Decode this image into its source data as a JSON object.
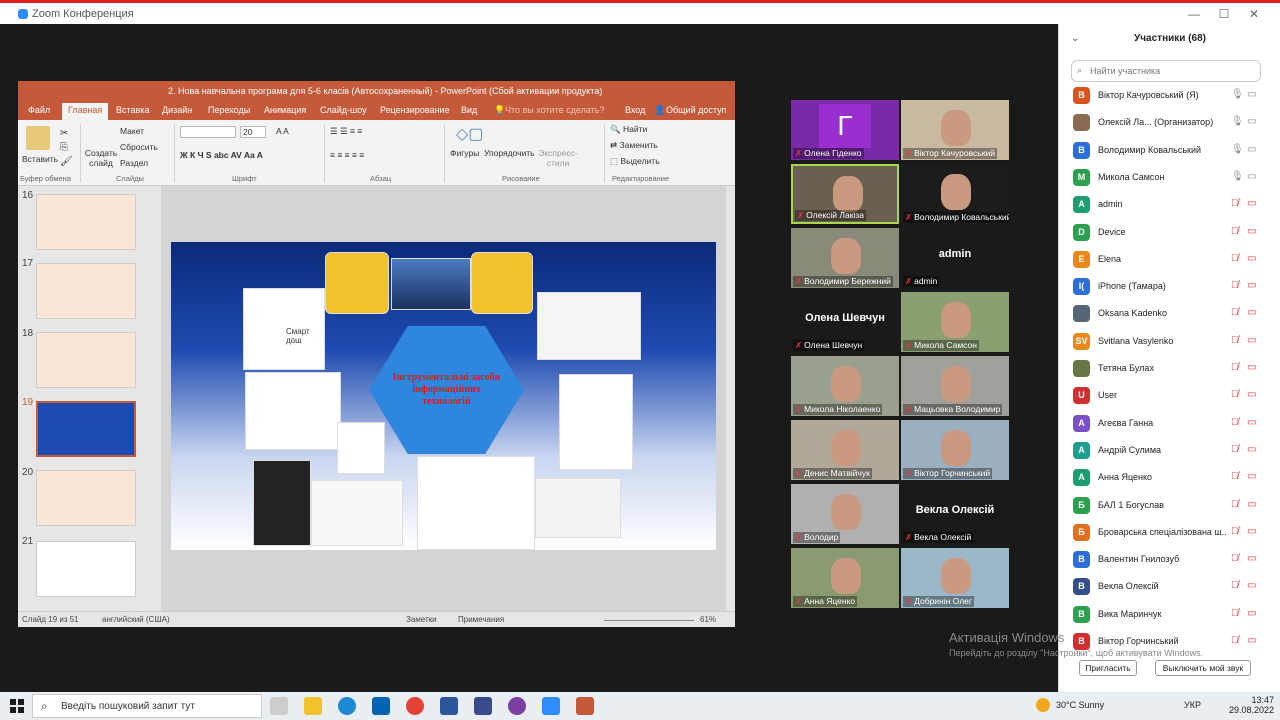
{
  "zoom": {
    "title": "Zoom Конференция",
    "min": "—",
    "max": "☐",
    "close": "✕"
  },
  "ppt": {
    "title": "2. Нова навчальна програма для 5-6 класів (Автосохраненный) - PowerPoint (Сбой активации продукта)",
    "tabs": [
      "Файл",
      "Главная",
      "Вставка",
      "Дизайн",
      "Переходы",
      "Анимация",
      "Слайд-шоу",
      "Рецензирование",
      "Вид"
    ],
    "tell": "Что вы хотите сделать?",
    "login": "Вход",
    "share": "Общий доступ",
    "ribbon": {
      "paste": "Вставить",
      "create": "Создать слайд",
      "layout": "Макет",
      "reset": "Сбросить",
      "section": "Раздел",
      "font_size": "20",
      "shapes": "Фигуры",
      "arrange": "Упорядочить",
      "styles": "Экспресс-стили",
      "find": "Найти",
      "replace": "Заменить",
      "select": "Выделить"
    },
    "groups": [
      "Буфер обмена",
      "Слайды",
      "Шрифт",
      "Абзац",
      "Рисование",
      "Редактирование"
    ],
    "thumbs": [
      "16",
      "17",
      "18",
      "19",
      "20",
      "21"
    ],
    "slide_text": "Інструментальні засоби інформаційних технологій",
    "smart_label": "Смарт дош",
    "status": {
      "slide": "Слайд 19 из 51",
      "lang": "английский (США)",
      "notes": "Заметки",
      "comments": "Примечания",
      "zoom": "61%"
    }
  },
  "videos": [
    {
      "name": "Олена Гіденко",
      "letter": "Г"
    },
    {
      "name": "Віктор Качуровський"
    },
    {
      "name": "Олексій Лакіза"
    },
    {
      "name": "Володимир Ковальський"
    },
    {
      "name": "Володимир Бережний"
    },
    {
      "name": "admin",
      "big": "admin"
    },
    {
      "name": "Олена Шевчун",
      "big": "Олена Шевчун"
    },
    {
      "name": "Микола Самсон"
    },
    {
      "name": "Микола Ніколаенко"
    },
    {
      "name": "Мацьовка Володимир"
    },
    {
      "name": "Денис Матвійчук"
    },
    {
      "name": "Віктор Горчинський"
    },
    {
      "name": "Володир"
    },
    {
      "name": "Векла Олексій",
      "big": "Векла Олексій"
    },
    {
      "name": "Анна Яценко"
    },
    {
      "name": "Добринін Олег"
    }
  ],
  "panel": {
    "title": "Участники (68)",
    "search": "Найти участника",
    "people": [
      {
        "n": "Віктор Качуровський (Я)",
        "a": "В",
        "c": "#d9531e",
        "mic": "on"
      },
      {
        "n": "Олексій Ла... (Организатор)",
        "a": "",
        "c": "#8a6a50",
        "mic": "on"
      },
      {
        "n": "Володимир Ковальський",
        "a": "В",
        "c": "#2d6fd6",
        "mic": "on"
      },
      {
        "n": "Микола Самсон",
        "a": "М",
        "c": "#2e9e4f",
        "mic": "on"
      },
      {
        "n": "admin",
        "a": "A",
        "c": "#1e9e6e",
        "mic": "off"
      },
      {
        "n": "Device",
        "a": "D",
        "c": "#2e9e4f",
        "mic": "off"
      },
      {
        "n": "Elena",
        "a": "E",
        "c": "#e88a1a",
        "mic": "off"
      },
      {
        "n": "iPhone (Тамара)",
        "a": "I(",
        "c": "#2d6fd6",
        "mic": "off"
      },
      {
        "n": "Oksana Kadenko",
        "a": "",
        "c": "#556677",
        "mic": "off"
      },
      {
        "n": "Svitlana Vasylenko",
        "a": "SV",
        "c": "#e88a1a",
        "mic": "off"
      },
      {
        "n": "Тетяна Булах",
        "a": "",
        "c": "#667744",
        "mic": "off"
      },
      {
        "n": "User",
        "a": "U",
        "c": "#d03030",
        "mic": "off"
      },
      {
        "n": "Агеєва Ганна",
        "a": "А",
        "c": "#7a4fc8",
        "mic": "off"
      },
      {
        "n": "Андрій Сулима",
        "a": "А",
        "c": "#1e9e8e",
        "mic": "off"
      },
      {
        "n": "Анна Яценко",
        "a": "А",
        "c": "#1e9e6e",
        "mic": "off"
      },
      {
        "n": "БАЛ 1 Богуслав",
        "a": "Б",
        "c": "#2e9e4f",
        "mic": "off"
      },
      {
        "n": "Броварська спеціалізована ш...",
        "a": "Б",
        "c": "#e07020",
        "mic": "off"
      },
      {
        "n": "Валентин Гнилозуб",
        "a": "В",
        "c": "#2d6fd6",
        "mic": "off"
      },
      {
        "n": "Векла Олексій",
        "a": "В",
        "c": "#334e88",
        "mic": "off"
      },
      {
        "n": "Вика Маринчук",
        "a": "В",
        "c": "#2e9e4f",
        "mic": "off"
      },
      {
        "n": "Віктор Горчинський",
        "a": "В",
        "c": "#d03030",
        "mic": "off"
      }
    ],
    "invite": "Пригласить",
    "mute": "Выключить мой звук"
  },
  "watermark": {
    "line1": "Активація Windows",
    "line2": "Перейдіть до розділу \"Настройки\", щоб активувати Windows."
  },
  "taskbar": {
    "search": "Введіть пошуковий запит тут",
    "weather": "30°C  Sunny",
    "lang": "УКР",
    "time": "13:47",
    "date": "29.08.2022"
  }
}
